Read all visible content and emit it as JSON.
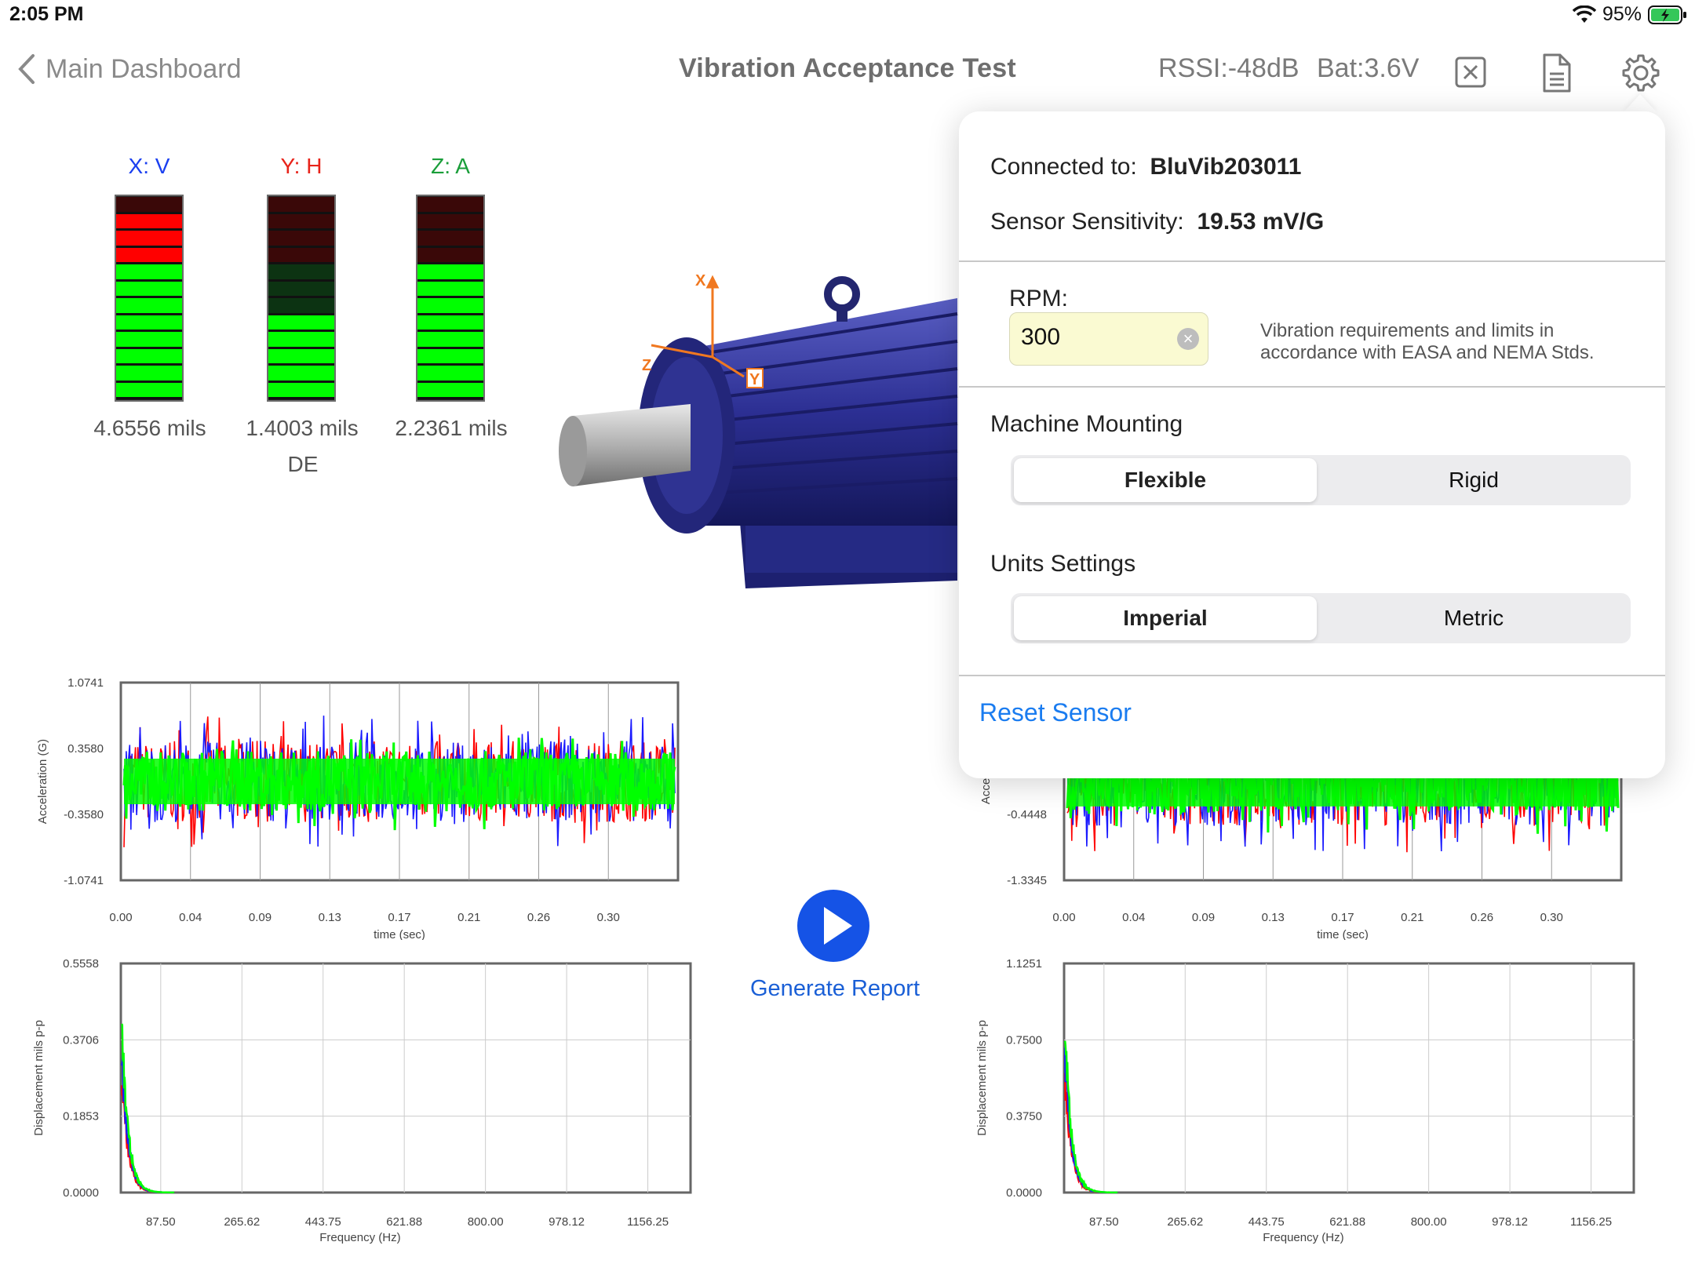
{
  "status": {
    "time": "2:05 PM",
    "battery_pct": "95%"
  },
  "nav": {
    "back_label": "Main Dashboard",
    "title": "Vibration Acceptance Test",
    "rssi": "RSSI:-48dB",
    "bat": "Bat:3.6V"
  },
  "gauges": [
    {
      "axis": "X: V",
      "color": "#1a3ff0",
      "value": "4.6556 mils",
      "red_lit": 3,
      "green_lit": 9
    },
    {
      "axis": "Y: H",
      "color": "#e8231a",
      "value": "1.4003 mils",
      "red_lit": 0,
      "green_lit": 5
    },
    {
      "axis": "Z: A",
      "color": "#1a9e3a",
      "value": "2.2361 mils",
      "red_lit": 0,
      "green_lit": 8
    }
  ],
  "gauge_location": "DE",
  "motor_axes": {
    "x": "X",
    "y": "Y",
    "z": "Z"
  },
  "panel": {
    "connected_label": "Connected to:",
    "connected_value": "BluVib203011",
    "sensitivity_label": "Sensor Sensitivity:",
    "sensitivity_value": "19.53 mV/G",
    "rpm_label": "RPM:",
    "rpm_value": "300",
    "note": "Vibration requirements and limits in accordance with EASA and NEMA Stds.",
    "mounting_label": "Machine Mounting",
    "mounting_options": [
      "Flexible",
      "Rigid"
    ],
    "mounting_selected": "Flexible",
    "units_label": "Units Settings",
    "units_options": [
      "Imperial",
      "Metric"
    ],
    "units_selected": "Imperial",
    "reset_label": "Reset Sensor"
  },
  "actions": {
    "generate_report": "Generate Report"
  },
  "colors": {
    "red": "#ff0000",
    "green": "#00ff00",
    "blue": "#1a1aff",
    "accent": "#1a7cf0"
  },
  "chart_data": [
    {
      "id": "time-left",
      "type": "line",
      "ylabel": "Acceleration (G)",
      "xlabel": "time (sec)",
      "yticks": [
        "1.0741",
        "0.3580",
        "-0.3580",
        "-1.0741"
      ],
      "xticks": [
        "0.00",
        "0.04",
        "0.09",
        "0.13",
        "0.17",
        "0.21",
        "0.26",
        "0.30"
      ],
      "ylim": [
        -1.0741,
        1.0741
      ],
      "series": [
        {
          "color": "#00ff00"
        },
        {
          "color": "#ff0000"
        },
        {
          "color": "#1a1aff"
        }
      ],
      "amplitude": 0.55
    },
    {
      "id": "time-right",
      "type": "line",
      "ylabel": "Accelera",
      "xlabel": "time (sec)",
      "yticks": [
        "-0.4448",
        "-1.3345"
      ],
      "xticks": [
        "0.00",
        "0.04",
        "0.09",
        "0.13",
        "0.17",
        "0.21",
        "0.26",
        "0.30"
      ],
      "ylim": [
        -1.3345,
        0.4448
      ],
      "series": [
        {
          "color": "#00ff00"
        },
        {
          "color": "#ff0000"
        },
        {
          "color": "#1a1aff"
        }
      ],
      "amplitude": 0.5
    },
    {
      "id": "freq-left",
      "type": "line",
      "ylabel": "Displacement mils p-p",
      "xlabel": "Frequency (Hz)",
      "yticks": [
        "0.5558",
        "0.3706",
        "0.1853",
        "0.0000"
      ],
      "xticks": [
        "87.50",
        "265.62",
        "443.75",
        "621.88",
        "800.00",
        "978.12",
        "1156.25"
      ],
      "ylim": [
        0,
        0.5558
      ],
      "xlim": [
        0,
        1250
      ],
      "peak": 0.5558
    },
    {
      "id": "freq-right",
      "type": "line",
      "ylabel": "Displacement mils p-p",
      "xlabel": "Frequency (Hz)",
      "yticks": [
        "1.1251",
        "0.7500",
        "0.3750",
        "0.0000"
      ],
      "xticks": [
        "87.50",
        "265.62",
        "443.75",
        "621.88",
        "800.00",
        "978.12",
        "1156.25"
      ],
      "ylim": [
        0,
        1.1251
      ],
      "xlim": [
        0,
        1250
      ],
      "peak": 1.1251
    }
  ]
}
